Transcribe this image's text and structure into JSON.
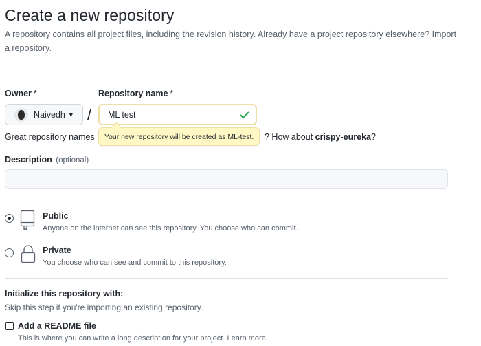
{
  "header": {
    "title": "Create a new repository",
    "subtitle": "A repository contains all project files, including the revision history. Already have a project repository elsewhere?",
    "import_link": "Import a repository."
  },
  "owner": {
    "label": "Owner",
    "required_mark": "*",
    "selected": "Naivedh"
  },
  "repo_name": {
    "label": "Repository name",
    "required_mark": "*",
    "value": "ML test",
    "valid": true
  },
  "hint": {
    "left_text": "Great repository names",
    "right_text": "? How about",
    "suggestion": "crispy-eureka",
    "suggestion_end": "?"
  },
  "tooltip": {
    "text": "Your new repository will be created as ML-test."
  },
  "description": {
    "label": "Description",
    "optional": "(optional)",
    "value": ""
  },
  "visibility": {
    "options": [
      {
        "title": "Public",
        "description": "Anyone on the internet can see this repository. You choose who can commit.",
        "selected": true,
        "icon": "repo-icon"
      },
      {
        "title": "Private",
        "description": "You choose who can see and commit to this repository.",
        "selected": false,
        "icon": "lock-icon"
      }
    ]
  },
  "initialize": {
    "title": "Initialize this repository with:",
    "description": "Skip this step if you're importing an existing repository.",
    "readme": {
      "label": "Add a README file",
      "description": "This is where you can write a long description for your project. Learn more.",
      "checked": false
    }
  },
  "colors": {
    "text": "#24292f",
    "muted": "#57606a",
    "tooltip_bg": "#fff8c5",
    "valid_check": "#2da44e"
  }
}
